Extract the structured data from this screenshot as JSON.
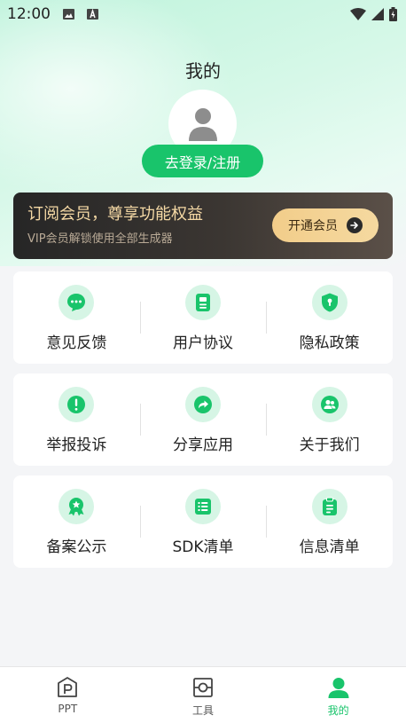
{
  "status_bar": {
    "time": "12:00"
  },
  "page": {
    "title": "我的"
  },
  "user": {
    "login_label": "去登录/注册"
  },
  "vip": {
    "title": "订阅会员，尊享功能权益",
    "subtitle": "VIP会员解锁使用全部生成器",
    "button_label": "开通会员"
  },
  "menu_groups": [
    {
      "items": [
        {
          "label": "意见反馈",
          "icon": "feedback-icon"
        },
        {
          "label": "用户协议",
          "icon": "agreement-icon"
        },
        {
          "label": "隐私政策",
          "icon": "privacy-shield-icon"
        }
      ]
    },
    {
      "items": [
        {
          "label": "举报投诉",
          "icon": "report-icon"
        },
        {
          "label": "分享应用",
          "icon": "share-icon"
        },
        {
          "label": "关于我们",
          "icon": "about-us-icon"
        }
      ]
    },
    {
      "items": [
        {
          "label": "备案公示",
          "icon": "badge-icon"
        },
        {
          "label": "SDK清单",
          "icon": "list-icon"
        },
        {
          "label": "信息清单",
          "icon": "clipboard-icon"
        }
      ]
    }
  ],
  "tabbar": {
    "items": [
      {
        "label": "PPT",
        "icon": "ppt-icon",
        "active": false
      },
      {
        "label": "工具",
        "icon": "tools-icon",
        "active": false
      },
      {
        "label": "我的",
        "icon": "profile-icon",
        "active": true
      }
    ]
  },
  "colors": {
    "accent": "#19c46b",
    "vip_gold": "#f5d9a5",
    "icon_bg": "#d6f5e5"
  }
}
